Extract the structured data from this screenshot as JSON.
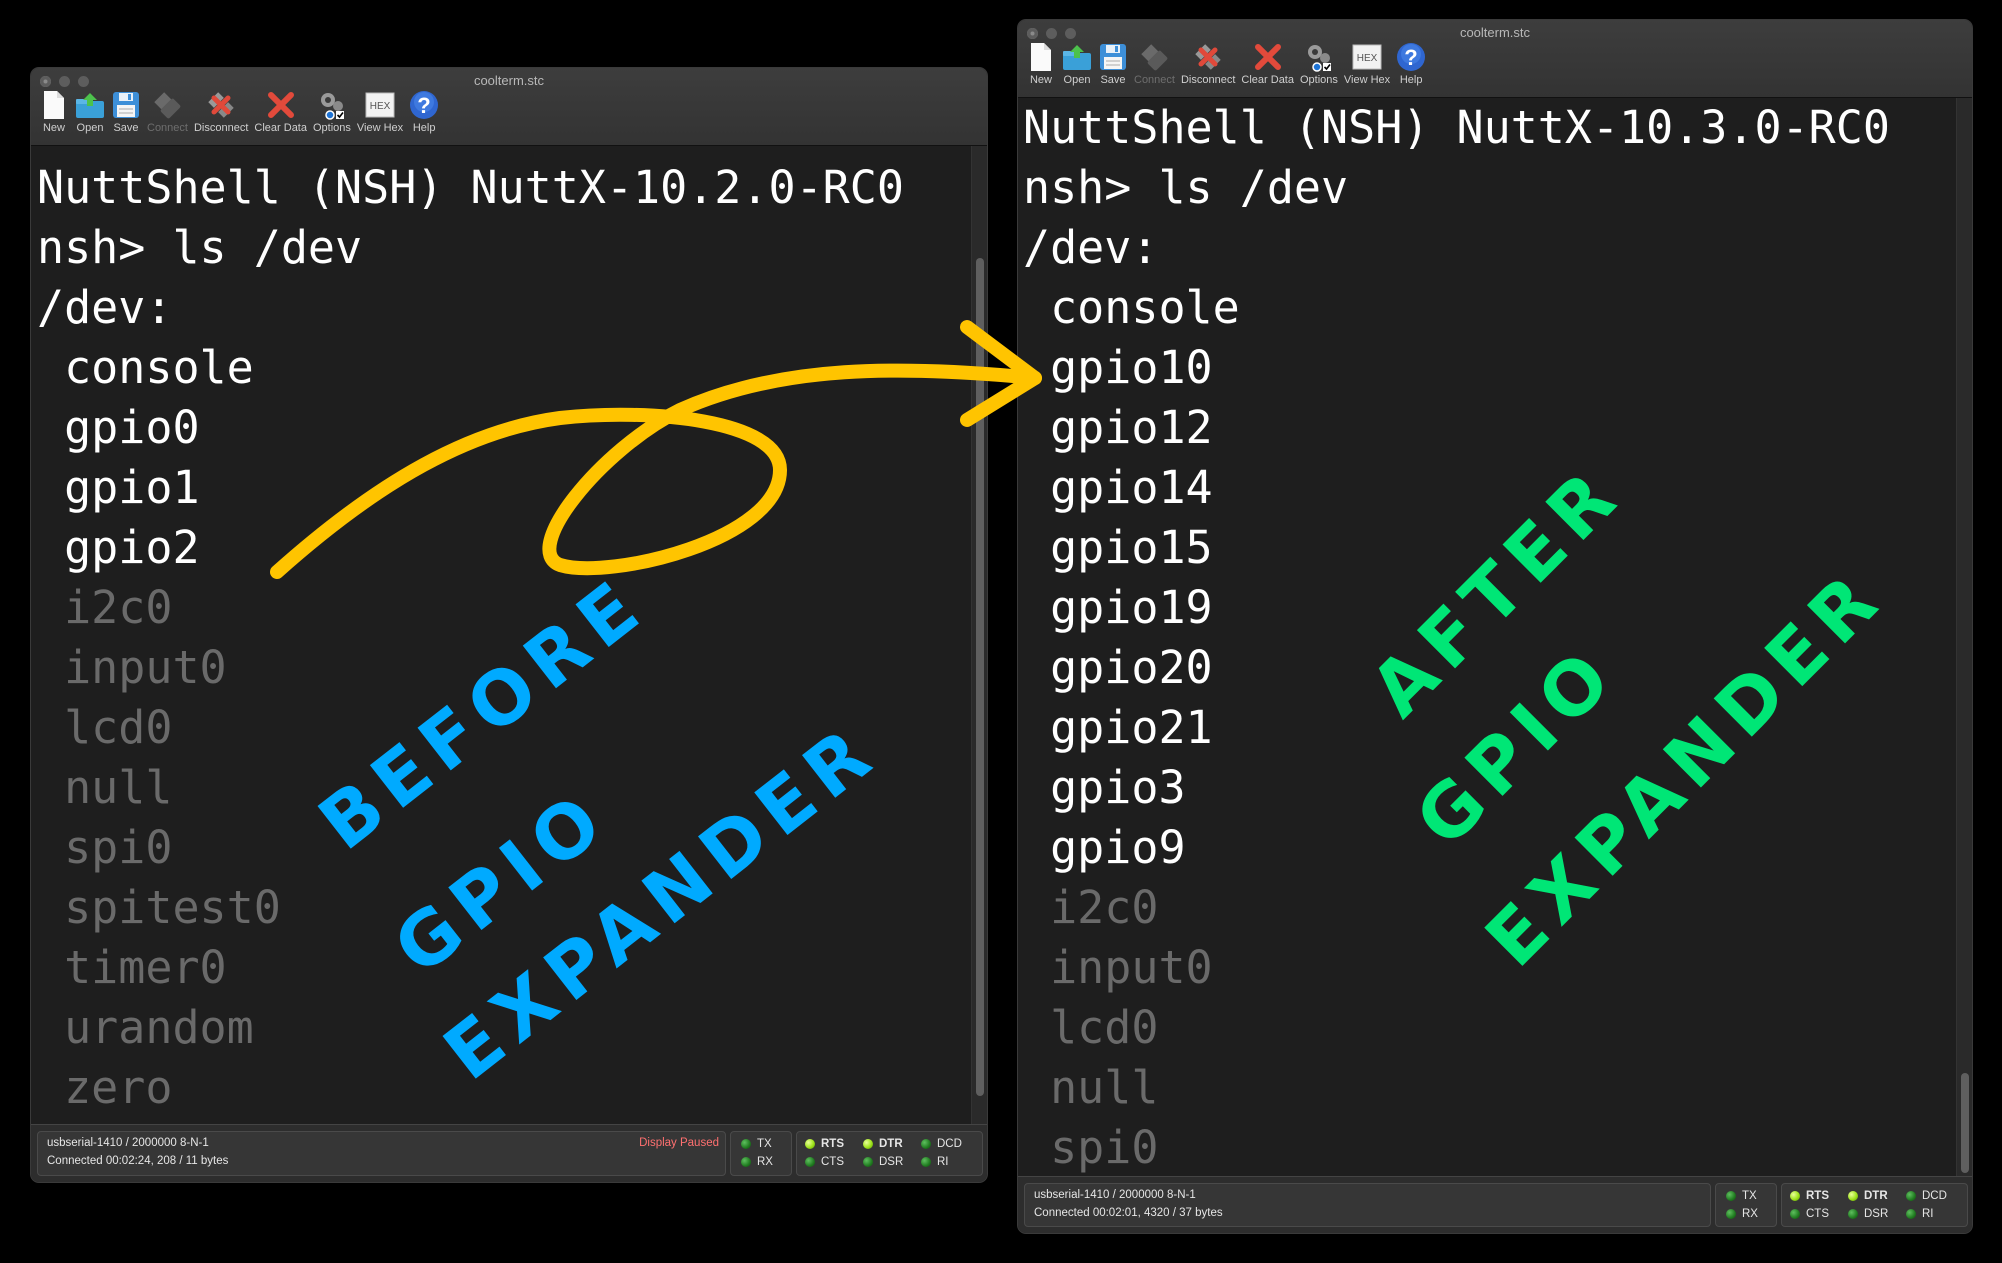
{
  "windows": [
    {
      "id": "before",
      "title": "coolterm.stc",
      "toolbar": [
        {
          "label": "New",
          "icon": "new-file-icon",
          "enabled": true
        },
        {
          "label": "Open",
          "icon": "open-folder-icon",
          "enabled": true
        },
        {
          "label": "Save",
          "icon": "save-disk-icon",
          "enabled": true
        },
        {
          "label": "Connect",
          "icon": "usb-plug-icon",
          "enabled": false
        },
        {
          "label": "Disconnect",
          "icon": "disconnect-icon",
          "enabled": true
        },
        {
          "label": "Clear Data",
          "icon": "clear-x-icon",
          "enabled": true
        },
        {
          "label": "Options",
          "icon": "gear-options-icon",
          "enabled": true
        },
        {
          "label": "View Hex",
          "icon": "hex-icon",
          "enabled": true
        },
        {
          "label": "Help",
          "icon": "help-icon",
          "enabled": true
        }
      ],
      "hex_icon_text": "HEX",
      "help_icon_text": "?",
      "terminal": {
        "lines": [
          {
            "text": "NuttShell (NSH) NuttX-10.2.0-RC0",
            "style": "bright"
          },
          {
            "text": "nsh> ls /dev",
            "style": "bright"
          },
          {
            "text": "/dev:",
            "style": "bright"
          },
          {
            "text": " console",
            "style": "bright"
          },
          {
            "text": " gpio0",
            "style": "bright"
          },
          {
            "text": " gpio1",
            "style": "bright"
          },
          {
            "text": " gpio2",
            "style": "bright"
          },
          {
            "text": " i2c0",
            "style": "dim"
          },
          {
            "text": " input0",
            "style": "dim"
          },
          {
            "text": " lcd0",
            "style": "dim"
          },
          {
            "text": " null",
            "style": "dim"
          },
          {
            "text": " spi0",
            "style": "dim"
          },
          {
            "text": " spitest0",
            "style": "dim"
          },
          {
            "text": " timer0",
            "style": "dim"
          },
          {
            "text": " urandom",
            "style": "dim"
          },
          {
            "text": " zero",
            "style": "dim"
          }
        ]
      },
      "status": {
        "port": "usbserial-1410 / 2000000 8-N-1",
        "connection": "Connected 00:02:24, 208 / 11 bytes",
        "display_state": "Display Paused",
        "leds": [
          {
            "label": "TX",
            "on": false,
            "bold": false
          },
          {
            "label": "RX",
            "on": false,
            "bold": false
          },
          {
            "label": "RTS",
            "on": true,
            "bold": true
          },
          {
            "label": "CTS",
            "on": false,
            "bold": false
          },
          {
            "label": "DTR",
            "on": true,
            "bold": true
          },
          {
            "label": "DSR",
            "on": false,
            "bold": false
          },
          {
            "label": "DCD",
            "on": false,
            "bold": false
          },
          {
            "label": "RI",
            "on": false,
            "bold": false
          }
        ]
      }
    },
    {
      "id": "after",
      "title": "coolterm.stc",
      "toolbar": [
        {
          "label": "New",
          "icon": "new-file-icon",
          "enabled": true
        },
        {
          "label": "Open",
          "icon": "open-folder-icon",
          "enabled": true
        },
        {
          "label": "Save",
          "icon": "save-disk-icon",
          "enabled": true
        },
        {
          "label": "Connect",
          "icon": "usb-plug-icon",
          "enabled": false
        },
        {
          "label": "Disconnect",
          "icon": "disconnect-icon",
          "enabled": true
        },
        {
          "label": "Clear Data",
          "icon": "clear-x-icon",
          "enabled": true
        },
        {
          "label": "Options",
          "icon": "gear-options-icon",
          "enabled": true
        },
        {
          "label": "View Hex",
          "icon": "hex-icon",
          "enabled": true
        },
        {
          "label": "Help",
          "icon": "help-icon",
          "enabled": true
        }
      ],
      "hex_icon_text": "HEX",
      "help_icon_text": "?",
      "terminal": {
        "lines": [
          {
            "text": "NuttShell (NSH) NuttX-10.3.0-RC0",
            "style": "bright"
          },
          {
            "text": "nsh> ls /dev",
            "style": "bright"
          },
          {
            "text": "/dev:",
            "style": "bright"
          },
          {
            "text": " console",
            "style": "bright"
          },
          {
            "text": " gpio10",
            "style": "bright"
          },
          {
            "text": " gpio12",
            "style": "bright"
          },
          {
            "text": " gpio14",
            "style": "bright"
          },
          {
            "text": " gpio15",
            "style": "bright"
          },
          {
            "text": " gpio19",
            "style": "bright"
          },
          {
            "text": " gpio20",
            "style": "bright"
          },
          {
            "text": " gpio21",
            "style": "bright"
          },
          {
            "text": " gpio3",
            "style": "bright"
          },
          {
            "text": " gpio9",
            "style": "bright"
          },
          {
            "text": " i2c0",
            "style": "dim"
          },
          {
            "text": " input0",
            "style": "dim"
          },
          {
            "text": " lcd0",
            "style": "dim"
          },
          {
            "text": " null",
            "style": "dim"
          },
          {
            "text": " spi0",
            "style": "dim"
          }
        ]
      },
      "status": {
        "port": "usbserial-1410 / 2000000 8-N-1",
        "connection": "Connected 00:02:01, 4320 / 37 bytes",
        "display_state": "",
        "leds": [
          {
            "label": "TX",
            "on": false,
            "bold": false
          },
          {
            "label": "RX",
            "on": false,
            "bold": false
          },
          {
            "label": "RTS",
            "on": true,
            "bold": true
          },
          {
            "label": "CTS",
            "on": false,
            "bold": false
          },
          {
            "label": "DTR",
            "on": true,
            "bold": true
          },
          {
            "label": "DSR",
            "on": false,
            "bold": false
          },
          {
            "label": "DCD",
            "on": false,
            "bold": false
          },
          {
            "label": "RI",
            "on": false,
            "bold": false
          }
        ]
      }
    }
  ],
  "annotations": {
    "before": {
      "lines": [
        "BEFORE",
        "GPIO",
        "EXPANDER"
      ],
      "color": "#00aaff"
    },
    "after": {
      "lines": [
        "AFTER",
        "GPIO",
        "EXPANDER"
      ],
      "color": "#00e676"
    },
    "arrow": {
      "color": "#ffc400",
      "meaning": "before-to-after"
    }
  }
}
